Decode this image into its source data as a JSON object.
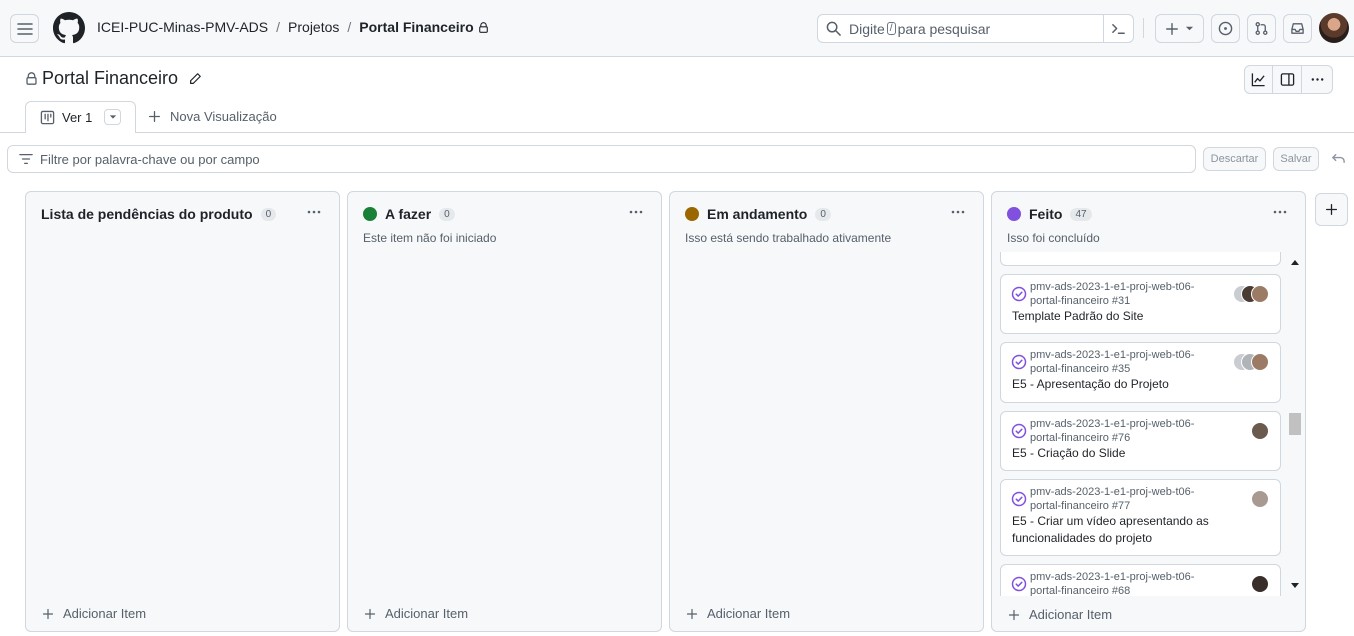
{
  "header": {
    "breadcrumb": {
      "org": "ICEI-PUC-Minas-PMV-ADS",
      "section": "Projetos",
      "project": "Portal Financeiro",
      "sep": "/"
    },
    "search": {
      "prefix": "Digite",
      "key": "/",
      "suffix": "para pesquisar"
    },
    "icons": [
      "menu-icon",
      "github-logo",
      "search-icon",
      "command-palette-icon",
      "plus-icon",
      "issues-icon",
      "pull-requests-icon",
      "inbox-icon"
    ]
  },
  "project": {
    "title": "Portal Financeiro"
  },
  "tabs": {
    "active": "Ver 1",
    "new_view": "Nova Visualização"
  },
  "filter": {
    "placeholder": "Filtre por palavra-chave ou por campo",
    "discard": "Descartar",
    "save": "Salvar"
  },
  "columns": [
    {
      "name": "Lista de pendências do produto",
      "count": "0",
      "description": "",
      "color": "",
      "add": "Adicionar Item"
    },
    {
      "name": "A fazer",
      "count": "0",
      "description": "Este item não foi iniciado",
      "color": "#1a7f37",
      "add": "Adicionar Item"
    },
    {
      "name": "Em andamento",
      "count": "0",
      "description": "Isso está sendo trabalhado ativamente",
      "color": "#9a6700",
      "add": "Adicionar Item"
    },
    {
      "name": "Feito",
      "count": "47",
      "description": "Isso foi concluído",
      "color": "#8250df",
      "add": "Adicionar Item"
    }
  ],
  "cards": [
    {
      "repo": "pmv-ads-2023-1-e1-proj-web-t06-portal-financeiro #31",
      "title": "Template Padrão do Site"
    },
    {
      "repo": "pmv-ads-2023-1-e1-proj-web-t06-portal-financeiro #35",
      "title": "E5 - Apresentação do Projeto"
    },
    {
      "repo": "pmv-ads-2023-1-e1-proj-web-t06-portal-financeiro #76",
      "title": "E5 - Criação do Slide"
    },
    {
      "repo": "pmv-ads-2023-1-e1-proj-web-t06-portal-financeiro #77",
      "title": "E5 - Criar um vídeo apresentando as funcionalidades do projeto"
    },
    {
      "repo": "pmv-ads-2023-1-e1-proj-web-t06-portal-financeiro #68",
      "title": ""
    }
  ],
  "theme": {
    "accent_done": "#8250df",
    "border": "#d0d7de",
    "muted": "#57606a"
  }
}
